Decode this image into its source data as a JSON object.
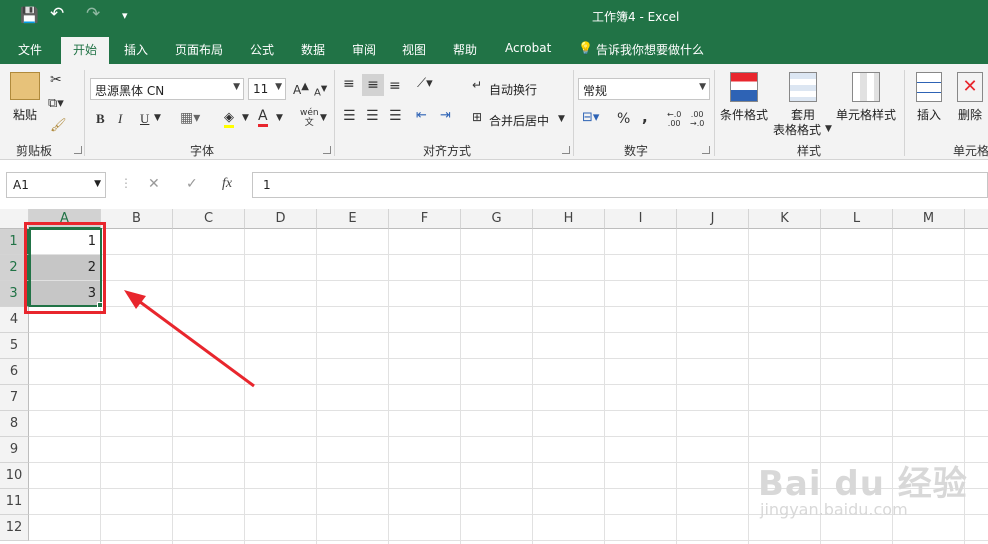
{
  "window": {
    "title": "工作簿4  -  Excel"
  },
  "quick_access": {
    "save": "💾",
    "undo": "↶",
    "redo": "↷",
    "customize": "▾"
  },
  "tabs": [
    {
      "label": "文件"
    },
    {
      "label": "开始"
    },
    {
      "label": "插入"
    },
    {
      "label": "页面布局"
    },
    {
      "label": "公式"
    },
    {
      "label": "数据"
    },
    {
      "label": "审阅"
    },
    {
      "label": "视图"
    },
    {
      "label": "帮助"
    },
    {
      "label": "Acrobat"
    },
    {
      "label": "告诉我你想要做什么"
    }
  ],
  "ribbon": {
    "clipboard": {
      "paste": "粘贴",
      "label": "剪贴板"
    },
    "font": {
      "name": "思源黑体 CN",
      "size": "11",
      "bold": "B",
      "italic": "I",
      "underline": "U",
      "label": "字体",
      "font_color_glyph": "A",
      "wen": "wén\n文"
    },
    "alignment": {
      "wrap": "自动换行",
      "merge": "合并后居中",
      "label": "对齐方式"
    },
    "number": {
      "format": "常规",
      "percent": "%",
      "comma": ",",
      "label": "数字"
    },
    "styles": {
      "conditional": "条件格式",
      "table_1": "套用",
      "table_2": "表格格式",
      "cell_styles": "单元格样式",
      "label": "样式"
    },
    "cells": {
      "insert": "插入",
      "delete": "删除",
      "label": "单元格"
    }
  },
  "formula_bar": {
    "name_box": "A1",
    "cancel": "✕",
    "enter": "✓",
    "fx": "fx",
    "value": "1"
  },
  "columns": [
    "A",
    "B",
    "C",
    "D",
    "E",
    "F",
    "G",
    "H",
    "I",
    "J",
    "K",
    "L",
    "M"
  ],
  "rows": [
    "1",
    "2",
    "3",
    "4",
    "5",
    "6",
    "7",
    "8",
    "9",
    "10",
    "11",
    "12"
  ],
  "cells": {
    "A1": "1",
    "A2": "2",
    "A3": "3"
  },
  "colors": {
    "accent": "#217346",
    "annotation": "#e8262d",
    "selection_fill": "#c6c6c6"
  },
  "watermark": {
    "brand": "Bai du 经验",
    "url": "jingyan.baidu.com"
  }
}
